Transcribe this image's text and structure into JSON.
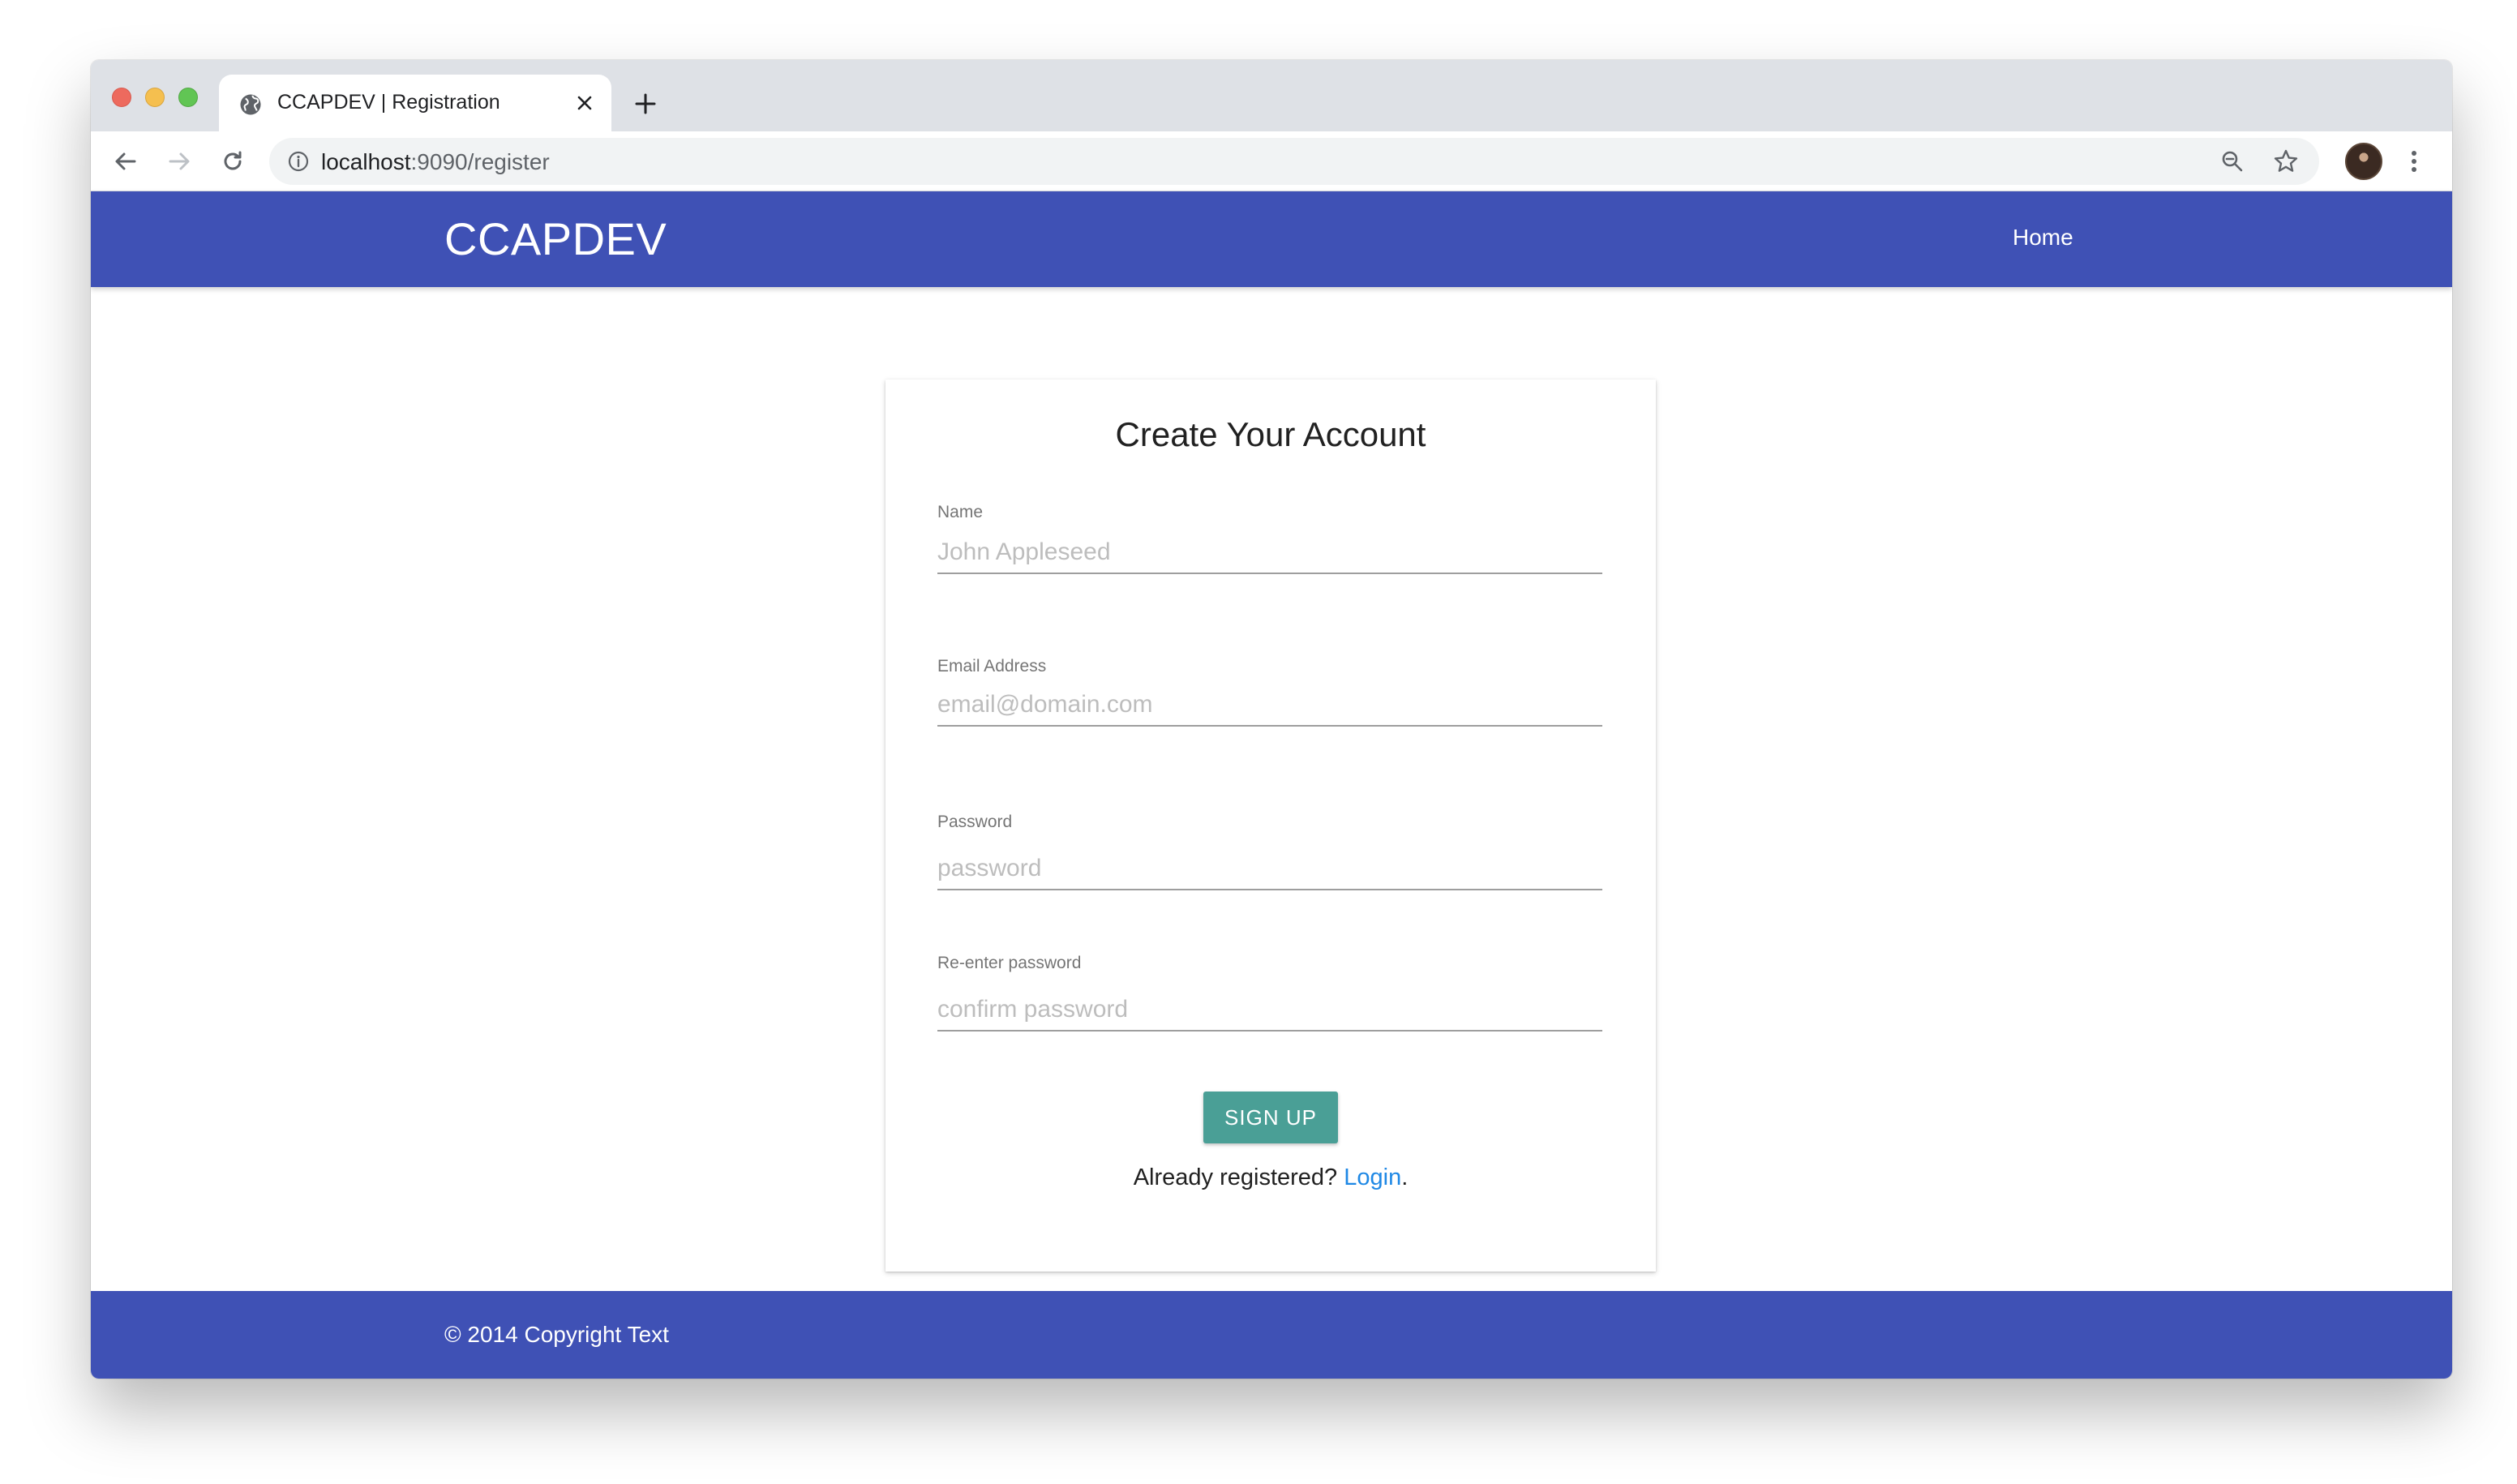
{
  "browser": {
    "tab": {
      "title": "CCAPDEV | Registration",
      "favicon": "globe-icon"
    },
    "new_tab_icon": "plus-icon",
    "nav_icons": [
      "back-arrow-icon",
      "forward-arrow-icon",
      "reload-icon"
    ],
    "address": {
      "host": "localhost",
      "rest": ":9090/register"
    },
    "toolbar_icons": [
      "zoom-out-icon",
      "star-icon",
      "kebab-menu-icon"
    ]
  },
  "navbar": {
    "brand": "CCAPDEV",
    "links": [
      "Home"
    ]
  },
  "form": {
    "title": "Create Your Account",
    "fields": [
      {
        "label": "Name",
        "placeholder": "John Appleseed",
        "value": ""
      },
      {
        "label": "Email Address",
        "placeholder": "email@domain.com",
        "value": ""
      },
      {
        "label": "Password",
        "placeholder": "password",
        "value": ""
      },
      {
        "label": "Re-enter password",
        "placeholder": "confirm password",
        "value": ""
      }
    ],
    "submit_label": "SIGN UP",
    "login_prompt": "Already registered?",
    "login_link": "Login",
    "login_suffix": "."
  },
  "footer": {
    "copyright": "© 2014 Copyright Text"
  },
  "colors": {
    "primary": "#3f51b5",
    "button": "#4a9f96",
    "link": "#1e88e5"
  }
}
